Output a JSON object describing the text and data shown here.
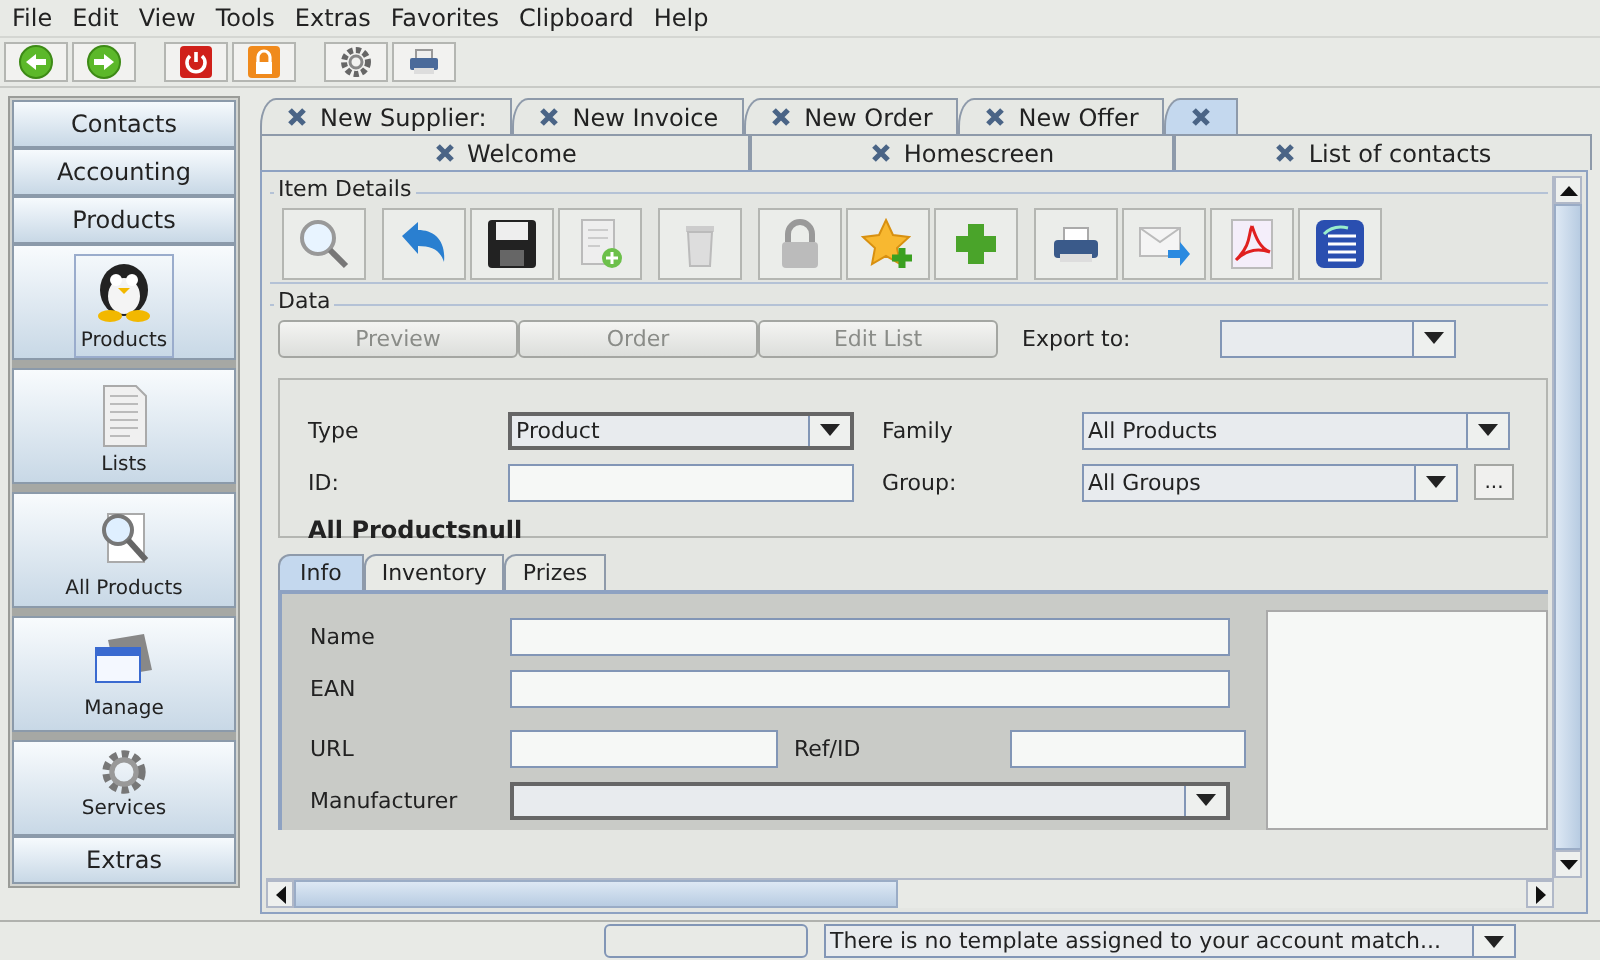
{
  "menu": [
    "File",
    "Edit",
    "View",
    "Tools",
    "Extras",
    "Favorites",
    "Clipboard",
    "Help"
  ],
  "sidebar": {
    "groups_top": [
      {
        "label": "Contacts"
      },
      {
        "label": "Accounting"
      },
      {
        "label": "Products"
      }
    ],
    "items": [
      {
        "label": "Products",
        "selected": true
      },
      {
        "label": "Lists",
        "selected": false
      },
      {
        "label": "All Products",
        "selected": false
      },
      {
        "label": "Manage",
        "selected": false
      },
      {
        "label": "Services",
        "selected": false
      }
    ],
    "groups_bottom": [
      {
        "label": "Extras"
      }
    ]
  },
  "tabs_back": [
    {
      "label": "New Supplier:",
      "selected": false
    },
    {
      "label": "New Invoice",
      "selected": false
    },
    {
      "label": "New Order",
      "selected": false
    },
    {
      "label": "New Offer",
      "selected": false
    },
    {
      "selected": true
    }
  ],
  "tabs_front": [
    {
      "label": "Welcome",
      "selected": false
    },
    {
      "label": "Homescreen",
      "selected": false
    },
    {
      "label": "List of contacts",
      "selected": false
    }
  ],
  "item_details": {
    "title": "Item Details"
  },
  "data": {
    "title": "Data",
    "buttons": [
      {
        "label": "Preview",
        "disabled": true
      },
      {
        "label": "Order",
        "disabled": true
      },
      {
        "label": "Edit List",
        "disabled": true
      }
    ],
    "export_label": "Export to:"
  },
  "form": {
    "type_label": "Type",
    "type_value": "Product",
    "family_label": "Family",
    "family_value": "All Products",
    "id_label": "ID:",
    "group_label": "Group:",
    "group_value": "All Groups",
    "more_button": "...",
    "heading": "All Productsnull"
  },
  "inner_tabs": [
    {
      "label": "Info",
      "selected": true
    },
    {
      "label": "Inventory",
      "selected": false
    },
    {
      "label": "Prizes",
      "selected": false
    }
  ],
  "info": {
    "name_label": "Name",
    "ean_label": "EAN",
    "url_label": "URL",
    "ref_label": "Ref/ID",
    "manufacturer_label": "Manufacturer"
  },
  "status": {
    "template": "There is no template assigned to your account match..."
  }
}
